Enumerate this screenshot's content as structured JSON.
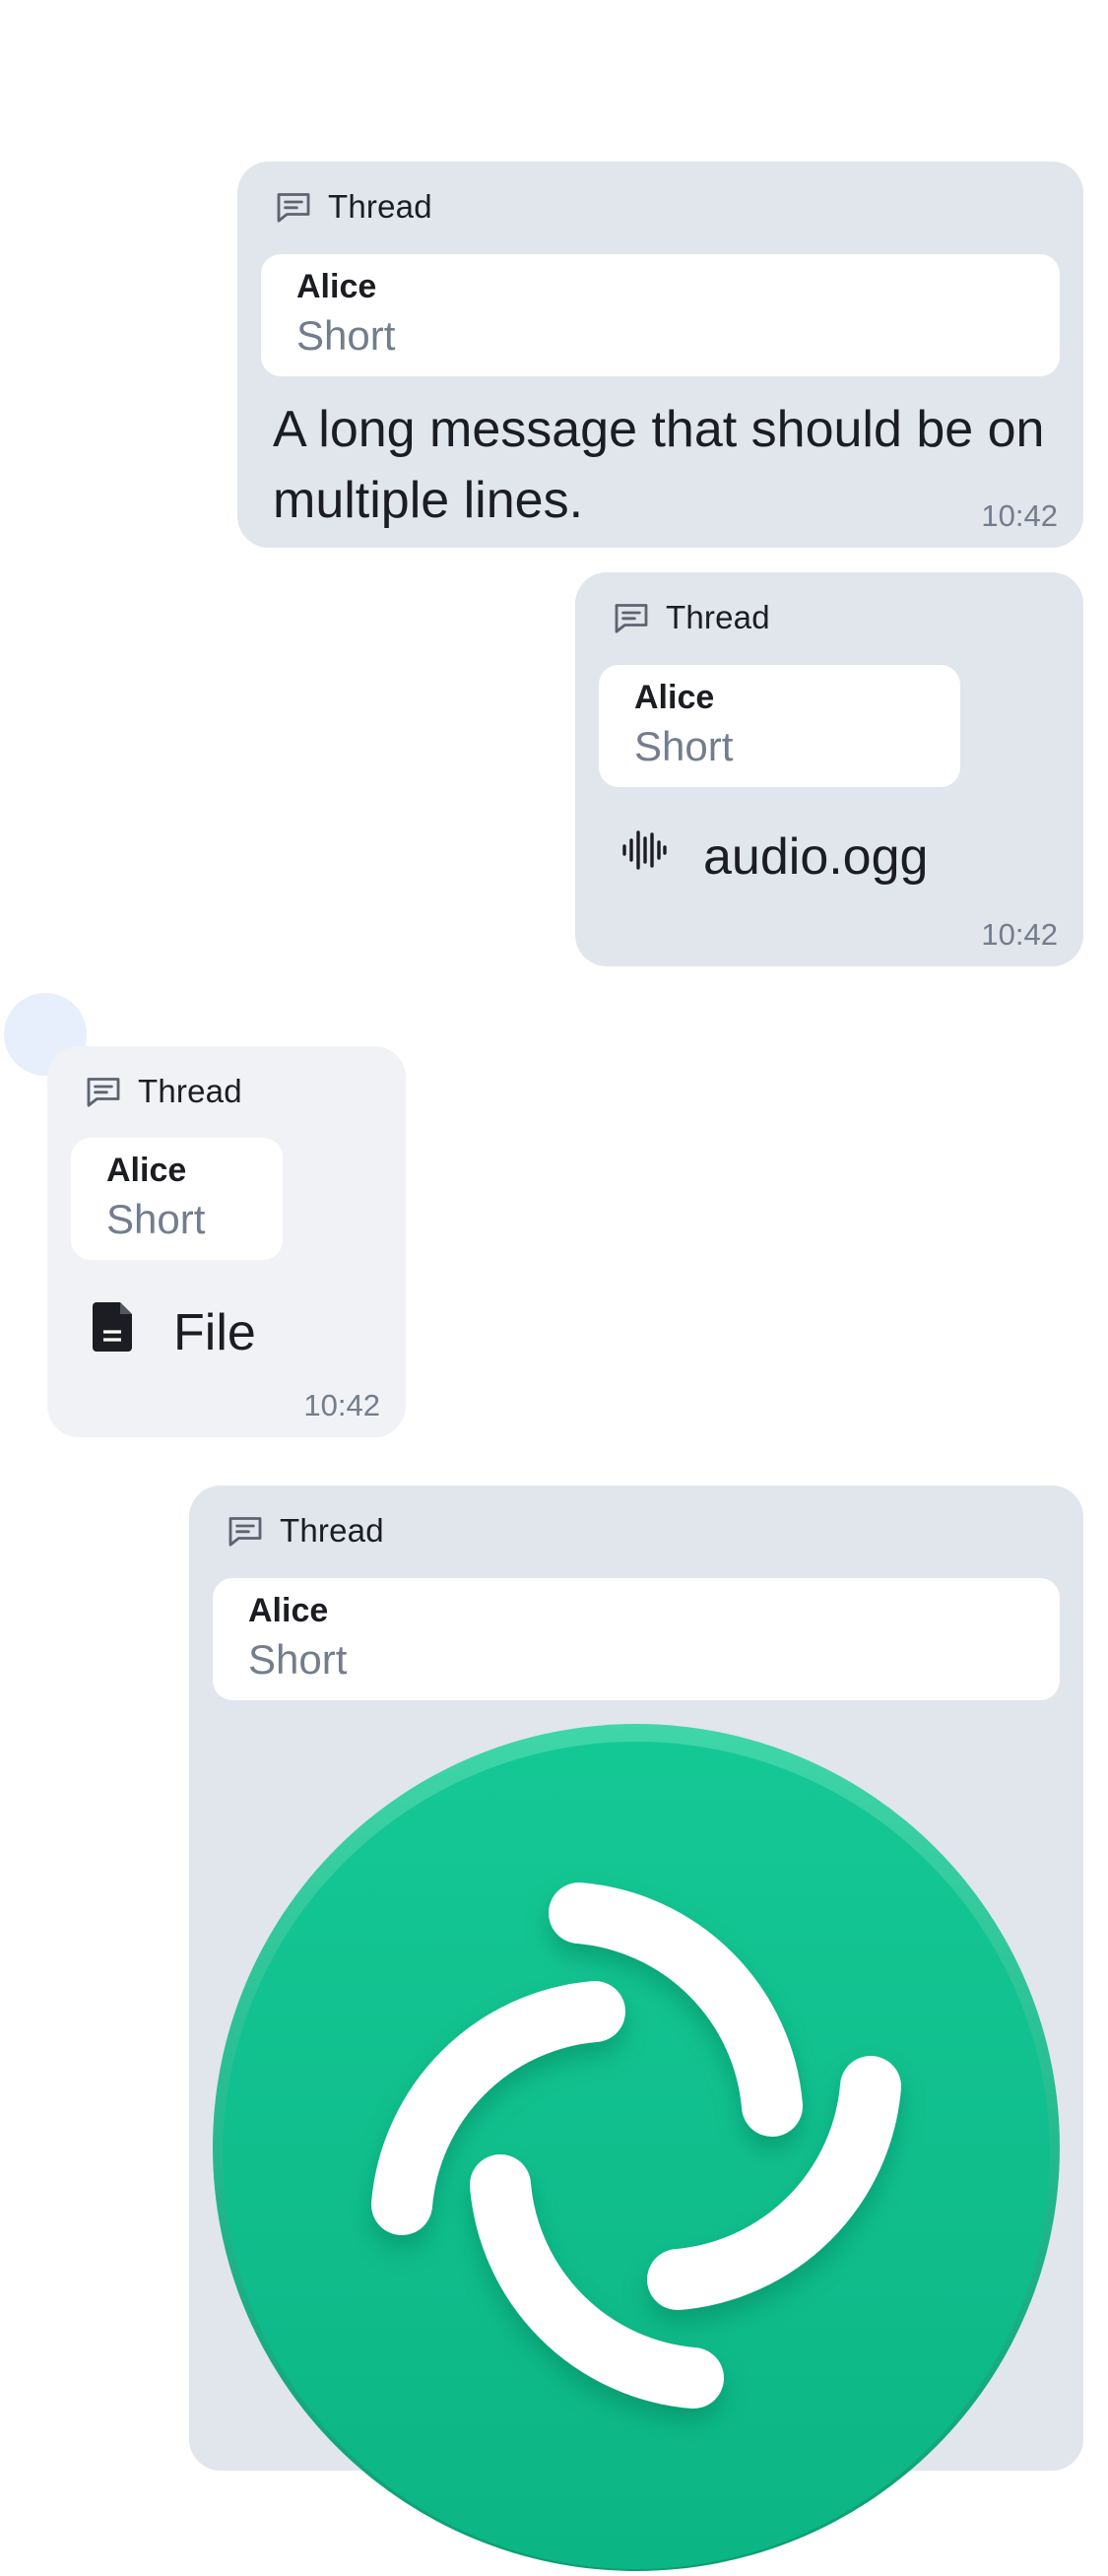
{
  "messages": [
    {
      "thread_label": "Thread",
      "reply": {
        "sender": "Alice",
        "text": "Short"
      },
      "body": "A long message that should be on multiple lines.",
      "time": "10:42"
    },
    {
      "thread_label": "Thread",
      "reply": {
        "sender": "Alice",
        "text": "Short"
      },
      "attachment": {
        "name": "audio.ogg",
        "icon": "audio-waveform-icon"
      },
      "time": "10:42"
    },
    {
      "thread_label": "Thread",
      "reply": {
        "sender": "Alice",
        "text": "Short"
      },
      "attachment": {
        "name": "File",
        "icon": "document-icon"
      },
      "time": "10:42"
    },
    {
      "thread_label": "Thread",
      "reply": {
        "sender": "Alice",
        "text": "Short"
      },
      "image": {
        "icon": "element-logo-icon"
      }
    }
  ],
  "colors": {
    "outgoing_bubble": "#e1e5ec",
    "incoming_bubble": "#f0f2f5",
    "logo_green": "#0dbd8b",
    "secondary_text": "#737d8c"
  }
}
